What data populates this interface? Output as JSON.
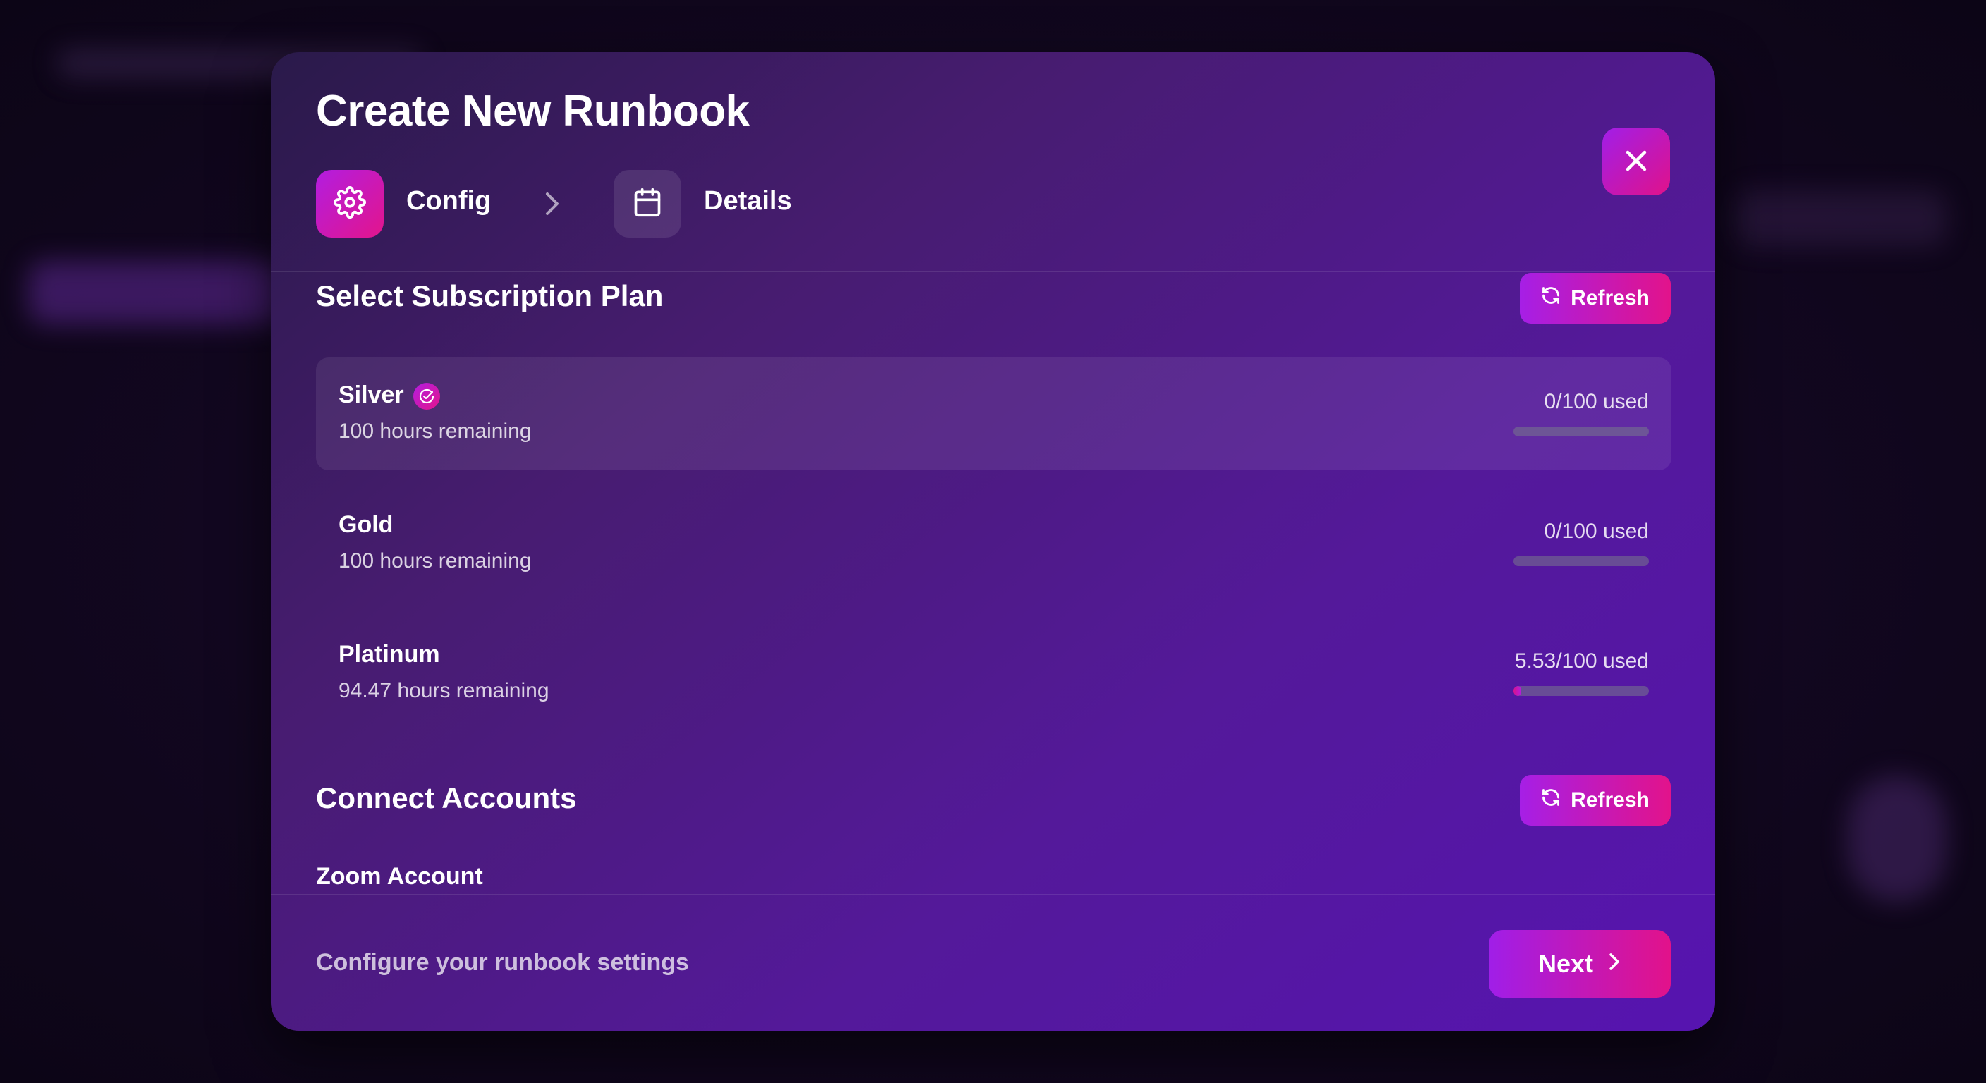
{
  "modal": {
    "title": "Create New Runbook",
    "close_icon": "close-icon"
  },
  "steps": [
    {
      "label": "Config",
      "icon": "gear-icon",
      "active": true
    },
    {
      "label": "Details",
      "icon": "calendar-icon",
      "active": false
    }
  ],
  "subscription": {
    "title": "Select Subscription Plan",
    "refresh_label": "Refresh",
    "plans": [
      {
        "name": "Silver",
        "remaining": "100 hours remaining",
        "usage": "0/100 used",
        "used_fraction": 0,
        "selected": true
      },
      {
        "name": "Gold",
        "remaining": "100 hours remaining",
        "usage": "0/100 used",
        "used_fraction": 0,
        "selected": false
      },
      {
        "name": "Platinum",
        "remaining": "94.47 hours remaining",
        "usage": "5.53/100 used",
        "used_fraction": 0.0553,
        "selected": false
      }
    ]
  },
  "accounts": {
    "title": "Connect Accounts",
    "refresh_label": "Refresh",
    "zoom_label": "Zoom Account"
  },
  "footer": {
    "hint": "Configure your runbook settings",
    "next_label": "Next"
  },
  "colors": {
    "accent_start": "#a61fe6",
    "accent_end": "#e2138b",
    "modal_bg": "#4a1a80"
  }
}
